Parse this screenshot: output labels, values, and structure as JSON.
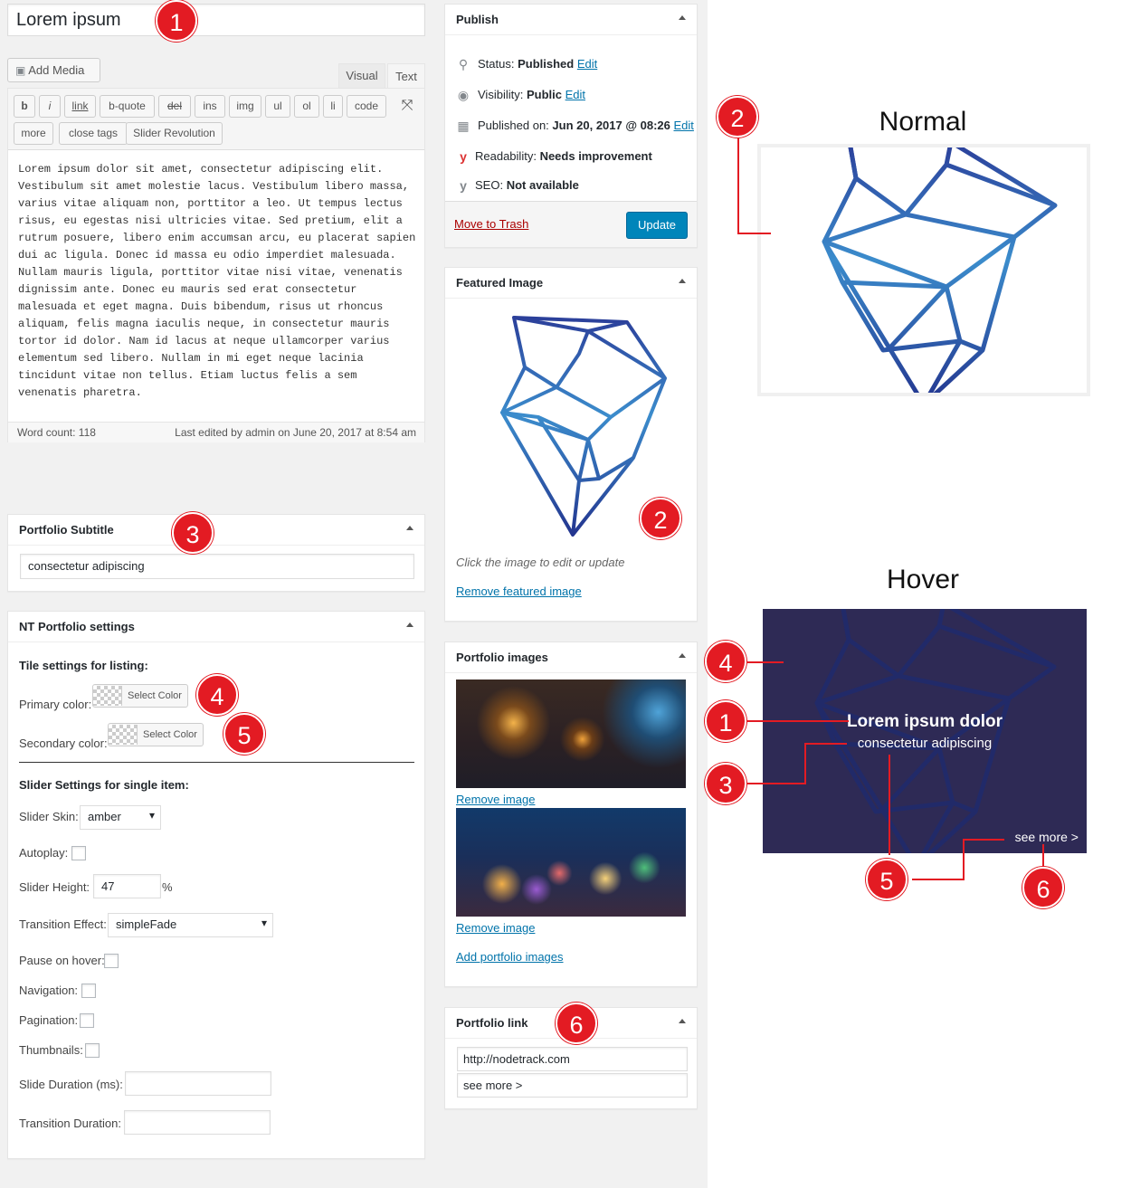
{
  "title_input": "Lorem ipsum",
  "editor": {
    "add_media": "Add Media",
    "tabs": [
      "Visual",
      "Text"
    ],
    "quicktags": [
      "b",
      "i",
      "link",
      "b-quote",
      "del",
      "ins",
      "img",
      "ul",
      "ol",
      "li",
      "code",
      "more",
      "close tags",
      "Slider Revolution"
    ],
    "content": "Lorem ipsum dolor sit amet, consectetur adipiscing elit. Vestibulum sit amet molestie lacus. Vestibulum libero massa, varius vitae aliquam non, porttitor a leo. Ut tempus lectus risus, eu egestas nisi ultricies vitae. Sed pretium, elit a rutrum posuere, libero enim accumsan arcu, eu placerat sapien dui ac ligula. Donec id massa eu odio imperdiet malesuada. Nullam mauris ligula, porttitor vitae nisi vitae, venenatis dignissim ante. Donec eu mauris sed erat consectetur malesuada et eget magna. Duis bibendum, risus ut rhoncus aliquam, felis magna iaculis neque, in consectetur mauris tortor id dolor. Nam id lacus at neque ullamcorper varius elementum sed libero. Nullam in mi eget neque lacinia tincidunt vitae non tellus. Etiam luctus felis a sem venenatis pharetra.",
    "word_count": "Word count: 118",
    "last_edited": "Last edited by admin on June 20, 2017 at 8:54 am"
  },
  "subtitle_box": {
    "title": "Portfolio Subtitle",
    "value": "consectetur adipiscing"
  },
  "settings_box": {
    "title": "NT Portfolio settings",
    "tile_heading": "Tile settings for listing:",
    "primary_label": "Primary color:",
    "secondary_label": "Secondary color:",
    "select_color": "Select Color",
    "slider_heading": "Slider Settings for single item:",
    "skin_label": "Slider Skin:",
    "skin_value": "amber",
    "autoplay_label": "Autoplay:",
    "height_label": "Slider Height:",
    "height_value": "47",
    "height_unit": "%",
    "effect_label": "Transition Effect:",
    "effect_value": "simpleFade",
    "pause_label": "Pause on hover:",
    "nav_label": "Navigation:",
    "pagination_label": "Pagination:",
    "thumbs_label": "Thumbnails:",
    "slide_duration_label": "Slide Duration (ms):",
    "transition_duration_label": "Transition Duration:"
  },
  "publish": {
    "title": "Publish",
    "status_label": "Status:",
    "status_value": "Published",
    "visibility_label": "Visibility:",
    "visibility_value": "Public",
    "published_label": "Published on:",
    "published_value": "Jun 20, 2017 @ 08:26",
    "edit": "Edit",
    "readability_label": "Readability:",
    "readability_value": "Needs improvement",
    "seo_label": "SEO:",
    "seo_value": "Not available",
    "trash": "Move to Trash",
    "update": "Update"
  },
  "featured": {
    "title": "Featured Image",
    "hint": "Click the image to edit or update",
    "remove": "Remove featured image"
  },
  "portfolio_images": {
    "title": "Portfolio images",
    "remove": "Remove image",
    "add": "Add portfolio images"
  },
  "portfolio_link": {
    "title": "Portfolio link",
    "url": "http://nodetrack.com",
    "label": "see more >"
  },
  "preview": {
    "normal_heading": "Normal",
    "hover_heading": "Hover",
    "hover_title": "Lorem ipsum dolor",
    "hover_subtitle": "consectetur adipiscing",
    "hover_link": "see more >"
  },
  "markers": [
    "1",
    "2",
    "3",
    "4",
    "5",
    "6"
  ],
  "colors": {
    "admin_bg": "#f1f1f1",
    "link": "#0073aa",
    "update_btn": "#0085ba",
    "marker": "#e31b23",
    "hover_bg": "#2e2a55",
    "trash": "#a00"
  }
}
